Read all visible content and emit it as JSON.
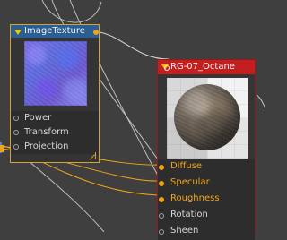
{
  "canvas": {
    "background": "#3f3f3f"
  },
  "nodes": {
    "image_texture": {
      "title": "ImageTexture",
      "header_color": "#2b5f93",
      "border_color": "#d4a437",
      "header_icon": "collapse-arrow-icon",
      "preview": "blue-normal-texture-preview",
      "ports": [
        {
          "label": "Power",
          "state": "unconnected"
        },
        {
          "label": "Transform",
          "state": "unconnected"
        },
        {
          "label": "Projection",
          "state": "unconnected"
        }
      ],
      "resize_icon": "resize-handle-icon"
    },
    "rg07_octane": {
      "title": "RG-07_Octane",
      "header_color": "#c41f1f",
      "border_color": "#8d1b1b",
      "header_icon": "collapse-arrow-icon",
      "preview": "stone-sphere-preview",
      "ports": [
        {
          "label": "Diffuse",
          "state": "connected"
        },
        {
          "label": "Specular",
          "state": "connected"
        },
        {
          "label": "Roughness",
          "state": "connected"
        },
        {
          "label": "Rotation",
          "state": "unconnected"
        },
        {
          "label": "Sheen",
          "state": "unconnected"
        }
      ]
    }
  },
  "wires": {
    "connected_color": "#f2a317",
    "disconnected_color": "#bfbfbf"
  }
}
